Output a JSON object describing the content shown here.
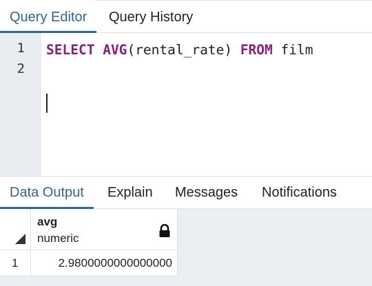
{
  "top_tabs": {
    "query_editor": "Query Editor",
    "query_history": "Query History",
    "active": "Query Editor"
  },
  "editor": {
    "line_numbers": [
      "1",
      "2"
    ],
    "line1": {
      "kw_select": "SELECT",
      "kw_avg": "AVG",
      "args": "(rental_rate)",
      "kw_from": "FROM",
      "table": "film"
    },
    "line2": ""
  },
  "bottom_tabs": {
    "data_output": "Data Output",
    "explain": "Explain",
    "messages": "Messages",
    "notifications": "Notifications",
    "active": "Data Output"
  },
  "result_grid": {
    "columns": [
      {
        "name": "avg",
        "type": "numeric",
        "icon": "lock-icon"
      }
    ],
    "rows": [
      {
        "row_number": "1",
        "avg": "2.9800000000000000"
      }
    ]
  },
  "colors": {
    "accent": "#326690",
    "keyword": "#8a1e85",
    "gutter": "#e9ecf0",
    "grid_background": "#ebeef2"
  }
}
